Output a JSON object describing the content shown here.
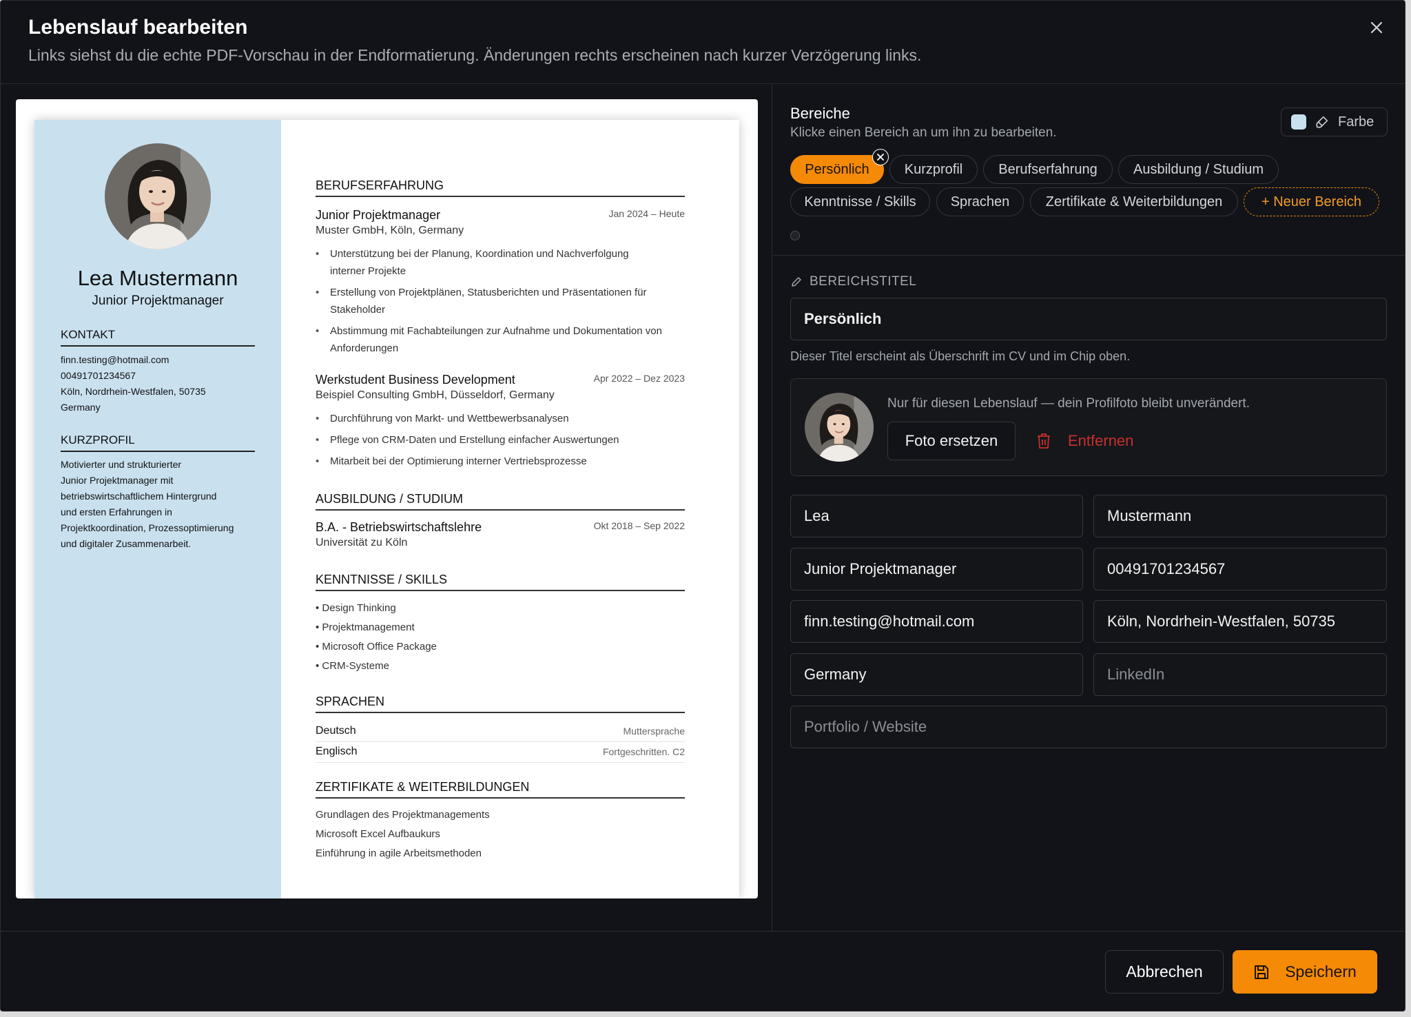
{
  "dialog": {
    "title": "Lebenslauf bearbeiten",
    "subtitle": "Links siehst du die echte PDF-Vorschau in der Endformatierung. Änderungen rechts erscheinen nach kurzer Verzögerung links."
  },
  "cv": {
    "theme_color": "#c9e1ef",
    "name": "Lea Mustermann",
    "role": "Junior Projektmanager",
    "contact_heading": "KONTAKT",
    "contact": [
      "finn.testing@hotmail.com",
      "00491701234567",
      "Köln, Nordrhein-Westfalen, 50735",
      "Germany"
    ],
    "profile_heading": "KURZPROFIL",
    "profile_lines": [
      "Motivierter und strukturierter",
      "Junior Projektmanager mit",
      "betriebswirtschaftlichem Hintergrund",
      "und ersten Erfahrungen in",
      "Projektkoordination, Prozessoptimierung",
      "und digitaler Zusammenarbeit."
    ],
    "experience_heading": "BERUFSERFAHRUNG",
    "jobs": [
      {
        "title": "Junior Projektmanager",
        "date": "Jan 2024 – Heute",
        "org": "Muster GmbH, Köln, Germany",
        "bullets": [
          [
            "Unterstützung bei der Planung, Koordination und Nachverfolgung",
            "interner Projekte"
          ],
          [
            "Erstellung von Projektplänen, Statusberichten und Präsentationen für",
            "Stakeholder"
          ],
          [
            "Abstimmung mit Fachabteilungen zur Aufnahme und Dokumentation von",
            "Anforderungen"
          ]
        ]
      },
      {
        "title": "Werkstudent Business Development",
        "date": "Apr 2022 – Dez 2023",
        "org": "Beispiel Consulting GmbH, Düsseldorf, Germany",
        "bullets": [
          [
            "Durchführung von Markt- und Wettbewerbsanalysen"
          ],
          [
            "Pflege von CRM-Daten und Erstellung einfacher Auswertungen"
          ],
          [
            "Mitarbeit bei der Optimierung interner Vertriebsprozesse"
          ]
        ]
      }
    ],
    "education_heading": "AUSBILDUNG / STUDIUM",
    "education": {
      "degree": "B.A. - Betriebswirtschaftslehre",
      "date": "Okt 2018 – Sep 2022",
      "school": "Universität zu Köln"
    },
    "skills_heading": "KENNTNISSE / SKILLS",
    "skills": [
      "• Design Thinking",
      "• Projektmanagement",
      "• Microsoft Office Package",
      "• CRM-Systeme"
    ],
    "languages_heading": "SPRACHEN",
    "languages": [
      {
        "name": "Deutsch",
        "level": "Muttersprache"
      },
      {
        "name": "Englisch",
        "level": "Fortgeschritten. C2"
      }
    ],
    "certs_heading": "ZERTIFIKATE & WEITERBILDUNGEN",
    "certs": [
      "Grundlagen des Projektmanagements",
      "Microsoft Excel Aufbaukurs",
      "Einführung in agile Arbeitsmethoden"
    ]
  },
  "editor": {
    "areas_title": "Bereiche",
    "areas_subtitle": "Klicke einen Bereich an um ihn zu bearbeiten.",
    "color_button": "Farbe",
    "sections": [
      "Persönlich",
      "Kurzprofil",
      "Berufserfahrung",
      "Ausbildung / Studium",
      "Kenntnisse / Skills",
      "Sprachen",
      "Zertifikate & Weiterbildungen"
    ],
    "new_section": "+ Neuer Bereich",
    "section_title_label": "BEREICHSTITEL",
    "section_title_value": "Persönlich",
    "section_title_hint": "Dieser Titel erscheint als Überschrift im CV und im Chip oben.",
    "photo_note": "Nur für diesen Lebenslauf — dein Profilfoto bleibt unverändert.",
    "replace_photo": "Foto ersetzen",
    "remove_photo": "Entfernen",
    "fields": {
      "first_name": "Lea",
      "last_name": "Mustermann",
      "job_title": "Junior Projektmanager",
      "phone": "00491701234567",
      "email": "finn.testing@hotmail.com",
      "location": "Köln, Nordrhein-Westfalen, 50735",
      "country": "Germany",
      "linkedin_placeholder": "LinkedIn",
      "portfolio_placeholder": "Portfolio / Website"
    }
  },
  "footer": {
    "cancel": "Abbrechen",
    "save": "Speichern"
  },
  "colors": {
    "accent": "#f58a07",
    "danger": "#c7302c",
    "background": "#111318"
  }
}
